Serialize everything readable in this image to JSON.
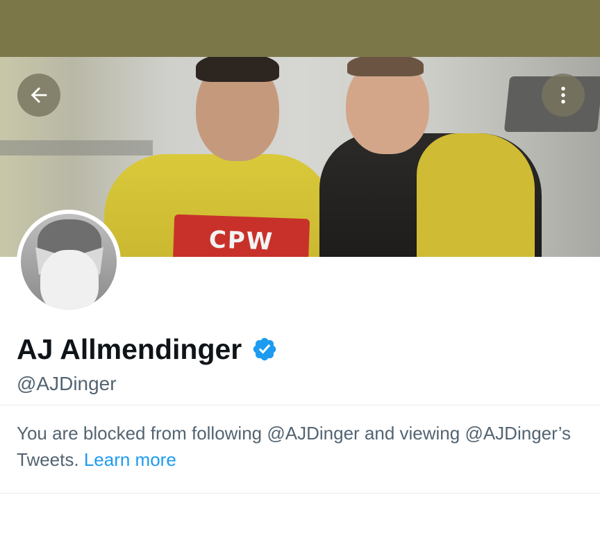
{
  "header": {
    "back_icon": "arrow-left-icon",
    "more_icon": "more-vertical-icon"
  },
  "banner": {
    "sponsor_text": "CPW"
  },
  "profile": {
    "display_name": "AJ Allmendinger",
    "verified_icon": "verified-badge-icon",
    "handle": "@AJDinger",
    "colors": {
      "verified": "#1d9bf0",
      "link": "#1d9bf0",
      "secondary_text": "#536471"
    }
  },
  "blocked": {
    "message": "You are blocked from following @AJDinger and viewing @AJDinger’s Tweets.",
    "learn_more_label": "Learn more"
  }
}
